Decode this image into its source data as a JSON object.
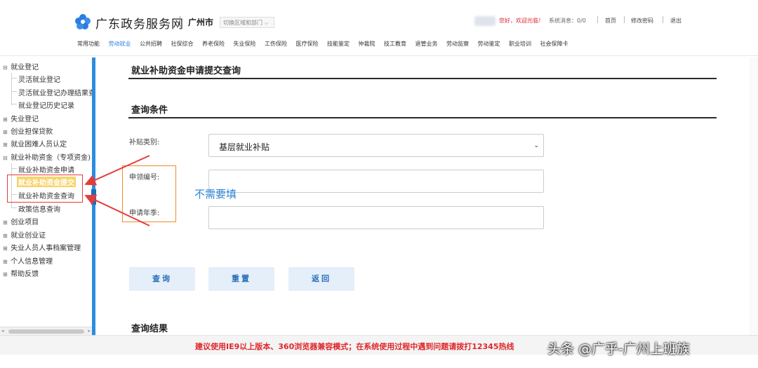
{
  "header": {
    "site_title": "广东政务服务网",
    "city": "广州市",
    "switch_region": "切换区域和部门",
    "greeting": "您好，欢迎光临！",
    "system_message": "系统消息：0/0",
    "links": [
      "首页",
      "修改密码",
      "退出"
    ]
  },
  "nav": {
    "items": [
      "常用功能",
      "劳动就业",
      "公共招聘",
      "社保综合",
      "养老保险",
      "失业保险",
      "工伤保险",
      "医疗保险",
      "技能鉴定",
      "仲裁院",
      "技工教育",
      "退管业务",
      "劳动监察",
      "劳动鉴定",
      "职业培训",
      "社会保障卡"
    ],
    "active": "劳动就业"
  },
  "sidebar": {
    "items": [
      {
        "label": "就业登记",
        "pm": "⊟"
      },
      {
        "label": "灵活就业登记"
      },
      {
        "label": "灵活就业登记办理结果查询"
      },
      {
        "label": "就业登记历史记录"
      },
      {
        "label": "失业登记",
        "pm": "⊞"
      },
      {
        "label": "创业担保贷款",
        "pm": "⊞"
      },
      {
        "label": "就业困难人员认定",
        "pm": "⊞"
      },
      {
        "label": "就业补助资金（专项资金)",
        "pm": "⊟"
      },
      {
        "label": "就业补助资金申请"
      },
      {
        "label": "就业补助资金提交"
      },
      {
        "label": "就业补助资金查询"
      },
      {
        "label": "政策信息查询"
      },
      {
        "label": "创业项目",
        "pm": "⊞"
      },
      {
        "label": "就业创业证",
        "pm": "⊞"
      },
      {
        "label": "失业人员人事档案管理",
        "pm": "⊞"
      },
      {
        "label": "个人信息管理",
        "pm": "⊞"
      },
      {
        "label": "帮助反馈",
        "pm": "⊞"
      }
    ]
  },
  "main": {
    "page_title": "就业补助资金申请提交查询",
    "query_section_title": "查询条件",
    "fields": {
      "subsidy_type_label": "补贴类别:",
      "subsidy_type_value": "基层就业补贴",
      "apply_no_label": "申领编号:",
      "apply_year_label": "申请年季:"
    },
    "buttons": {
      "query": "查询",
      "reset": "重置",
      "back": "返回"
    },
    "result_section_title": "查询结果"
  },
  "annotation": {
    "note": "不需要填",
    "colors": {
      "red": "#e63b3b",
      "orange": "#f08a2a",
      "blue": "#2a86d8"
    }
  },
  "footer": {
    "notice": "建议使用IE9以上版本、360浏览器兼容模式；在系统使用过程中遇到问题请拨打12345热线",
    "watermark": "头条 @广乎-广州上班族"
  },
  "icons": {
    "logo": "flower-logo-icon"
  },
  "colors": {
    "accent": "#2a7de1",
    "splitter": "#2c8de0",
    "highlight": "#f7d46a",
    "notice": "#e0262a"
  }
}
